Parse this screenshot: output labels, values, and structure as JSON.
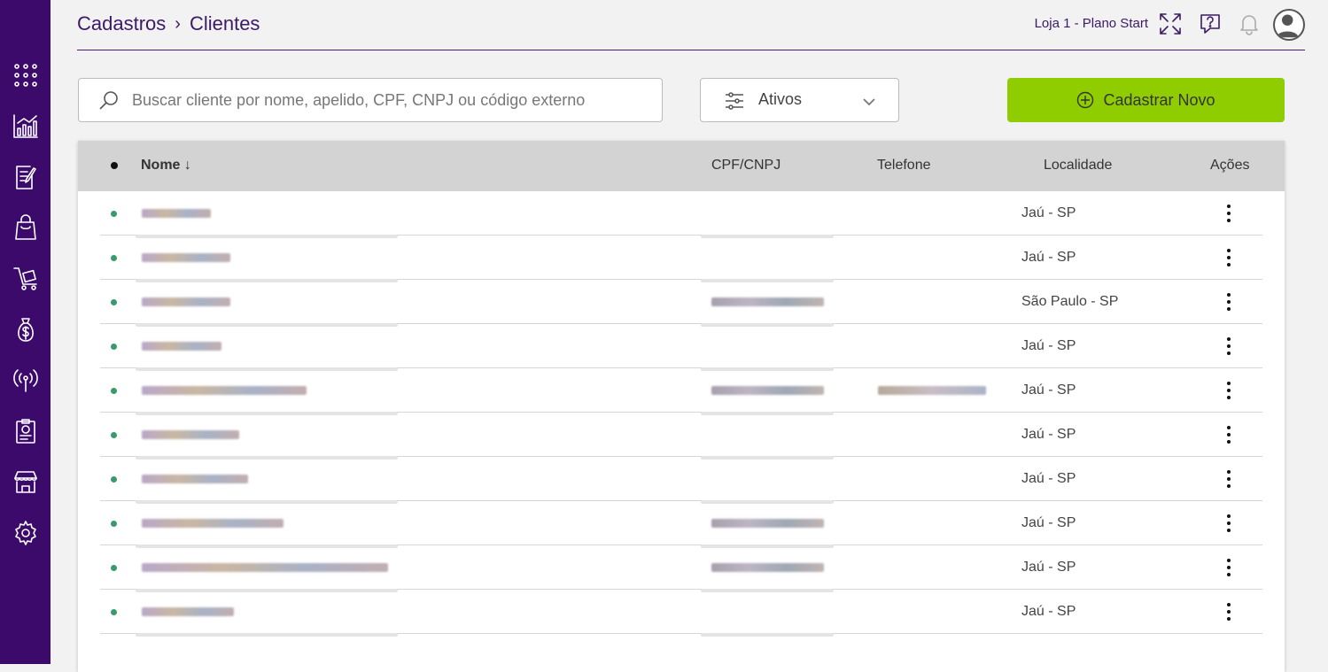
{
  "sidebar": {
    "items": [
      {
        "name": "apps-grid-icon"
      },
      {
        "name": "chart-icon"
      },
      {
        "name": "document-edit-icon"
      },
      {
        "name": "shopping-bag-icon"
      },
      {
        "name": "cart-icon"
      },
      {
        "name": "money-bag-icon"
      },
      {
        "name": "broadcast-icon"
      },
      {
        "name": "report-icon"
      },
      {
        "name": "store-icon"
      },
      {
        "name": "gear-icon"
      }
    ]
  },
  "header": {
    "breadcrumb": [
      "Cadastros",
      "Clientes"
    ],
    "store_label": "Loja 1 - Plano Start"
  },
  "toolbar": {
    "search_placeholder": "Buscar cliente por nome, apelido, CPF, CNPJ ou código externo",
    "filter_label": "Ativos",
    "add_label": "Cadastrar Novo"
  },
  "table": {
    "headers": {
      "name": "Nome",
      "doc": "CPF/CNPJ",
      "phone": "Telefone",
      "location": "Localidade",
      "actions": "Ações"
    },
    "rows": [
      {
        "location": "Jaú - SP"
      },
      {
        "location": "Jaú - SP"
      },
      {
        "location": "São Paulo - SP"
      },
      {
        "location": "Jaú - SP"
      },
      {
        "location": "Jaú - SP"
      },
      {
        "location": "Jaú - SP"
      },
      {
        "location": "Jaú - SP"
      },
      {
        "location": "Jaú - SP"
      },
      {
        "location": "Jaú - SP"
      },
      {
        "location": "Jaú - SP"
      }
    ]
  },
  "colors": {
    "sidebar": "#3b0a6b",
    "accent": "#8fcc00",
    "status_active": "#3a9a6a"
  }
}
